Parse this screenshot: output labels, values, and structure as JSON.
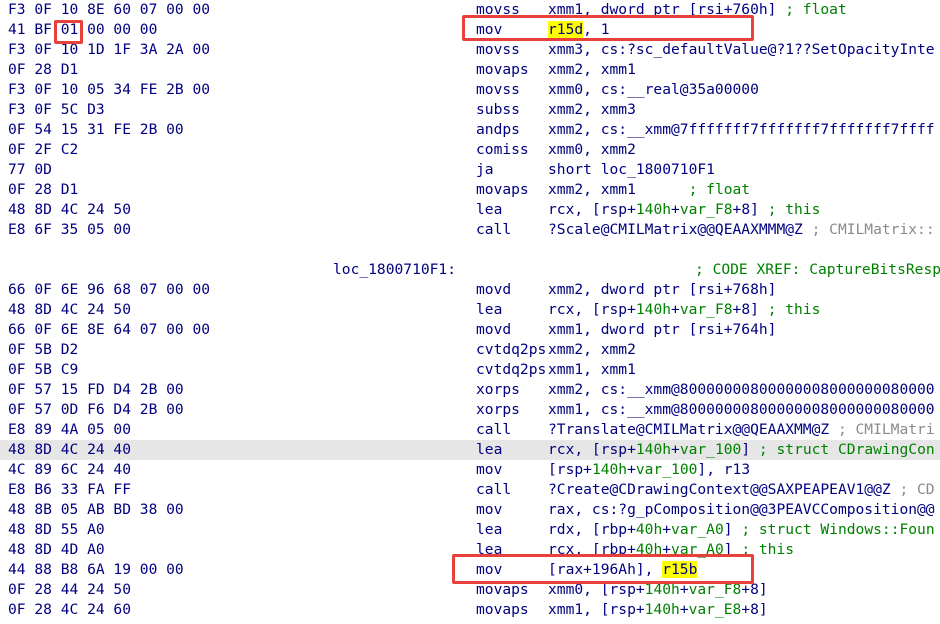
{
  "disasm": {
    "rows": [
      {
        "bytes": "F3 0F 10 8E 60 07 00 00",
        "mn": "movss",
        "ops": [
          {
            "t": "xmm1, dword ptr [rsi+760h]"
          },
          {
            "t": " ; float",
            "c": "cm"
          }
        ]
      },
      {
        "bytes": "41 BF 01 00 00 00",
        "mn": "mov",
        "ops": [
          {
            "t": "r15d",
            "c": "reg"
          },
          {
            "t": ", 1"
          }
        ]
      },
      {
        "bytes": "F3 0F 10 1D 1F 3A 2A 00",
        "mn": "movss",
        "ops": [
          {
            "t": "xmm3, cs:?sc_defaultValue@?1??SetOpacityInte"
          }
        ]
      },
      {
        "bytes": "0F 28 D1",
        "mn": "movaps",
        "ops": [
          {
            "t": "xmm2, xmm1"
          }
        ]
      },
      {
        "bytes": "F3 0F 10 05 34 FE 2B 00",
        "mn": "movss",
        "ops": [
          {
            "t": "xmm0, cs:__real@35a00000"
          }
        ]
      },
      {
        "bytes": "F3 0F 5C D3",
        "mn": "subss",
        "ops": [
          {
            "t": "xmm2, xmm3"
          }
        ]
      },
      {
        "bytes": "0F 54 15 31 FE 2B 00",
        "mn": "andps",
        "ops": [
          {
            "t": "xmm2, cs:__xmm@7fffffff7fffffff7fffffff7ffff"
          }
        ]
      },
      {
        "bytes": "0F 2F C2",
        "mn": "comiss",
        "ops": [
          {
            "t": "xmm0, xmm2"
          }
        ]
      },
      {
        "bytes": "77 0D",
        "mn": "ja",
        "ops": [
          {
            "t": "short loc_1800710F1"
          }
        ]
      },
      {
        "bytes": "0F 28 D1",
        "mn": "movaps",
        "ops": [
          {
            "t": "xmm2, xmm1      "
          },
          {
            "t": "; float",
            "c": "cm"
          }
        ]
      },
      {
        "bytes": "48 8D 4C 24 50",
        "mn": "lea",
        "ops": [
          {
            "t": "rcx, [rsp+"
          },
          {
            "t": "140h",
            "c": "g"
          },
          {
            "t": "+"
          },
          {
            "t": "var_F8",
            "c": "g"
          },
          {
            "t": "+8] "
          },
          {
            "t": "; this",
            "c": "cm"
          }
        ]
      },
      {
        "bytes": "E8 6F 35 05 00",
        "mn": "call",
        "ops": [
          {
            "t": "?Scale@CMILMatrix@@QEAAXMMM@Z "
          },
          {
            "t": "; CMILMatrix::",
            "c": "gy"
          }
        ]
      },
      {
        "bytes": "",
        "mn": "",
        "ops": []
      },
      {
        "bytes": "",
        "mn": "",
        "ops": [],
        "label": "loc_1800710F1:",
        "xref": "; CODE XREF: CaptureBitsResp"
      },
      {
        "bytes": "66 0F 6E 96 68 07 00 00",
        "mn": "movd",
        "ops": [
          {
            "t": "xmm2, dword ptr [rsi+768h]"
          }
        ]
      },
      {
        "bytes": "48 8D 4C 24 50",
        "mn": "lea",
        "ops": [
          {
            "t": "rcx, [rsp+"
          },
          {
            "t": "140h",
            "c": "g"
          },
          {
            "t": "+"
          },
          {
            "t": "var_F8",
            "c": "g"
          },
          {
            "t": "+8] "
          },
          {
            "t": "; this",
            "c": "cm"
          }
        ]
      },
      {
        "bytes": "66 0F 6E 8E 64 07 00 00",
        "mn": "movd",
        "ops": [
          {
            "t": "xmm1, dword ptr [rsi+764h]"
          }
        ]
      },
      {
        "bytes": "0F 5B D2",
        "mn": "cvtdq2ps",
        "ops": [
          {
            "t": "xmm2, xmm2"
          }
        ]
      },
      {
        "bytes": "0F 5B C9",
        "mn": "cvtdq2ps",
        "ops": [
          {
            "t": "xmm1, xmm1"
          }
        ]
      },
      {
        "bytes": "0F 57 15 FD D4 2B 00",
        "mn": "xorps",
        "ops": [
          {
            "t": "xmm2, cs:__xmm@80000000800000008000000080000"
          }
        ]
      },
      {
        "bytes": "0F 57 0D F6 D4 2B 00",
        "mn": "xorps",
        "ops": [
          {
            "t": "xmm1, cs:__xmm@80000000800000008000000080000"
          }
        ]
      },
      {
        "bytes": "E8 89 4A 05 00",
        "mn": "call",
        "ops": [
          {
            "t": "?Translate@CMILMatrix@@QEAAXMM@Z "
          },
          {
            "t": "; CMILMatri",
            "c": "gy"
          }
        ]
      },
      {
        "bytes": "48 8D 4C 24 40",
        "mn": "lea",
        "hl": true,
        "ops": [
          {
            "t": "rcx, [rsp+"
          },
          {
            "t": "140h",
            "c": "g"
          },
          {
            "t": "+"
          },
          {
            "t": "var_100",
            "c": "g"
          },
          {
            "t": "] "
          },
          {
            "t": "; struct CDrawingCon",
            "c": "cm"
          }
        ]
      },
      {
        "bytes": "4C 89 6C 24 40",
        "mn": "mov",
        "ops": [
          {
            "t": "[rsp+"
          },
          {
            "t": "140h",
            "c": "g"
          },
          {
            "t": "+"
          },
          {
            "t": "var_100",
            "c": "g"
          },
          {
            "t": "], r13"
          }
        ]
      },
      {
        "bytes": "E8 B6 33 FA FF",
        "mn": "call",
        "ops": [
          {
            "t": "?Create@CDrawingContext@@SAXPEAPEAV1@@Z "
          },
          {
            "t": "; CD",
            "c": "gy"
          }
        ]
      },
      {
        "bytes": "48 8B 05 AB BD 38 00",
        "mn": "mov",
        "ops": [
          {
            "t": "rax, cs:?g_pComposition@@3PEAVCComposition@@"
          }
        ]
      },
      {
        "bytes": "48 8D 55 A0",
        "mn": "lea",
        "ops": [
          {
            "t": "rdx, [rbp+"
          },
          {
            "t": "40h",
            "c": "g"
          },
          {
            "t": "+"
          },
          {
            "t": "var_A0",
            "c": "g"
          },
          {
            "t": "] "
          },
          {
            "t": "; struct Windows::Foun",
            "c": "cm"
          }
        ]
      },
      {
        "bytes": "48 8D 4D A0",
        "mn": "lea",
        "ops": [
          {
            "t": "rcx, [rbp+"
          },
          {
            "t": "40h",
            "c": "g"
          },
          {
            "t": "+"
          },
          {
            "t": "var_A0",
            "c": "g"
          },
          {
            "t": "] "
          },
          {
            "t": "; this",
            "c": "cm"
          }
        ]
      },
      {
        "bytes": "44 88 B8 6A 19 00 00",
        "mn": "mov",
        "ops": [
          {
            "t": "[rax+196Ah], "
          },
          {
            "t": "r15b",
            "c": "reg"
          }
        ]
      },
      {
        "bytes": "0F 28 44 24 50",
        "mn": "movaps",
        "ops": [
          {
            "t": "xmm0, [rsp+"
          },
          {
            "t": "140h",
            "c": "g"
          },
          {
            "t": "+"
          },
          {
            "t": "var_F8",
            "c": "g"
          },
          {
            "t": "+8]"
          }
        ]
      },
      {
        "bytes": "0F 28 4C 24 60",
        "mn": "movaps",
        "ops": [
          {
            "t": "xmm1, [rsp+"
          },
          {
            "t": "140h",
            "c": "g"
          },
          {
            "t": "+"
          },
          {
            "t": "var_E8",
            "c": "g"
          },
          {
            "t": "+8]"
          }
        ]
      }
    ]
  },
  "colors": {
    "text": "#000080",
    "green": "#008000",
    "highlight_register": "#ffff00",
    "annotation_box": "#e8403b",
    "current_line": "#e6e6e6"
  }
}
